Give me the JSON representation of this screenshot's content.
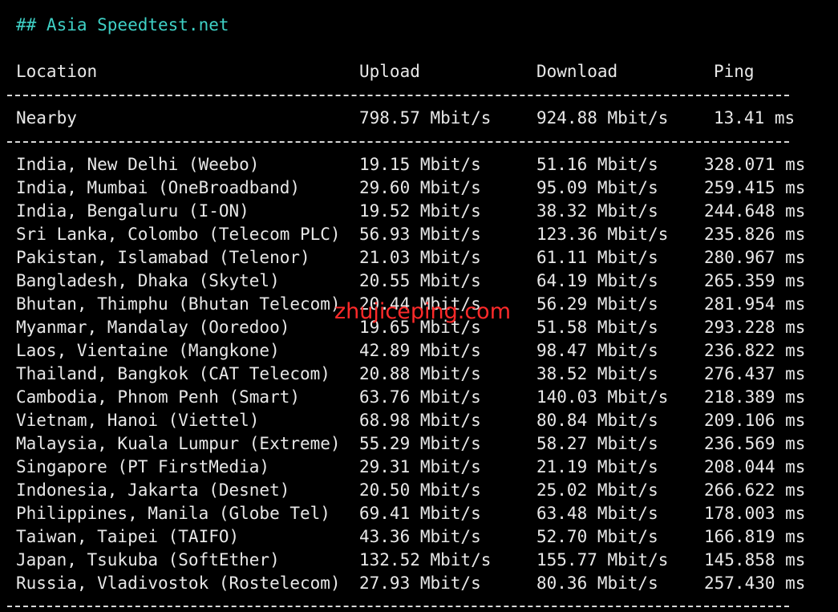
{
  "title": "## Asia Speedtest.net",
  "headers": {
    "location": "Location",
    "upload": "Upload",
    "download": "Download",
    "ping": "Ping"
  },
  "nearby": {
    "location": "Nearby",
    "upload": "798.57 Mbit/s",
    "download": "924.88 Mbit/s",
    "ping": "13.41 ms"
  },
  "rows": [
    {
      "location": "India, New Delhi (Weebo)",
      "upload": "19.15 Mbit/s",
      "download": "51.16 Mbit/s",
      "ping": "328.071 ms"
    },
    {
      "location": "India, Mumbai (OneBroadband)",
      "upload": "29.60 Mbit/s",
      "download": "95.09 Mbit/s",
      "ping": "259.415 ms"
    },
    {
      "location": "India, Bengaluru (I-ON)",
      "upload": "19.52 Mbit/s",
      "download": "38.32 Mbit/s",
      "ping": "244.648 ms"
    },
    {
      "location": "Sri Lanka, Colombo (Telecom PLC)",
      "upload": "56.93 Mbit/s",
      "download": "123.36 Mbit/s",
      "ping": "235.826 ms"
    },
    {
      "location": "Pakistan, Islamabad (Telenor)",
      "upload": "21.03 Mbit/s",
      "download": "61.11 Mbit/s",
      "ping": "280.967 ms"
    },
    {
      "location": "Bangladesh, Dhaka (Skytel)",
      "upload": "20.55 Mbit/s",
      "download": "64.19 Mbit/s",
      "ping": "265.359 ms"
    },
    {
      "location": "Bhutan, Thimphu (Bhutan Telecom)",
      "upload": "20.44 Mbit/s",
      "download": "56.29 Mbit/s",
      "ping": "281.954 ms"
    },
    {
      "location": "Myanmar, Mandalay (Ooredoo)",
      "upload": "19.65 Mbit/s",
      "download": "51.58 Mbit/s",
      "ping": "293.228 ms"
    },
    {
      "location": "Laos, Vientaine (Mangkone)",
      "upload": "42.89 Mbit/s",
      "download": "98.47 Mbit/s",
      "ping": "236.822 ms"
    },
    {
      "location": "Thailand, Bangkok (CAT Telecom)",
      "upload": "20.88 Mbit/s",
      "download": "38.52 Mbit/s",
      "ping": "276.437 ms"
    },
    {
      "location": "Cambodia, Phnom Penh (Smart)",
      "upload": "63.76 Mbit/s",
      "download": "140.03 Mbit/s",
      "ping": "218.389 ms"
    },
    {
      "location": "Vietnam, Hanoi (Viettel)",
      "upload": "68.98 Mbit/s",
      "download": "80.84 Mbit/s",
      "ping": "209.106 ms"
    },
    {
      "location": "Malaysia, Kuala Lumpur (Extreme)",
      "upload": "55.29 Mbit/s",
      "download": "58.27 Mbit/s",
      "ping": "236.569 ms"
    },
    {
      "location": "Singapore (PT FirstMedia)",
      "upload": "29.31 Mbit/s",
      "download": "21.19 Mbit/s",
      "ping": "208.044 ms"
    },
    {
      "location": "Indonesia, Jakarta (Desnet)",
      "upload": "20.50 Mbit/s",
      "download": "25.02 Mbit/s",
      "ping": "266.622 ms"
    },
    {
      "location": "Philippines, Manila (Globe Tel)",
      "upload": "69.41 Mbit/s",
      "download": "63.48 Mbit/s",
      "ping": "178.003 ms"
    },
    {
      "location": "Taiwan, Taipei (TAIFO)",
      "upload": "43.36 Mbit/s",
      "download": "52.70 Mbit/s",
      "ping": "166.819 ms"
    },
    {
      "location": "Japan, Tsukuba (SoftEther)",
      "upload": "132.52 Mbit/s",
      "download": "155.77 Mbit/s",
      "ping": "145.858 ms"
    },
    {
      "location": "Russia, Vladivostok (Rostelecom)",
      "upload": "27.93 Mbit/s",
      "download": "80.36 Mbit/s",
      "ping": "257.430 ms"
    }
  ],
  "watermark": "zhujiceping.com"
}
